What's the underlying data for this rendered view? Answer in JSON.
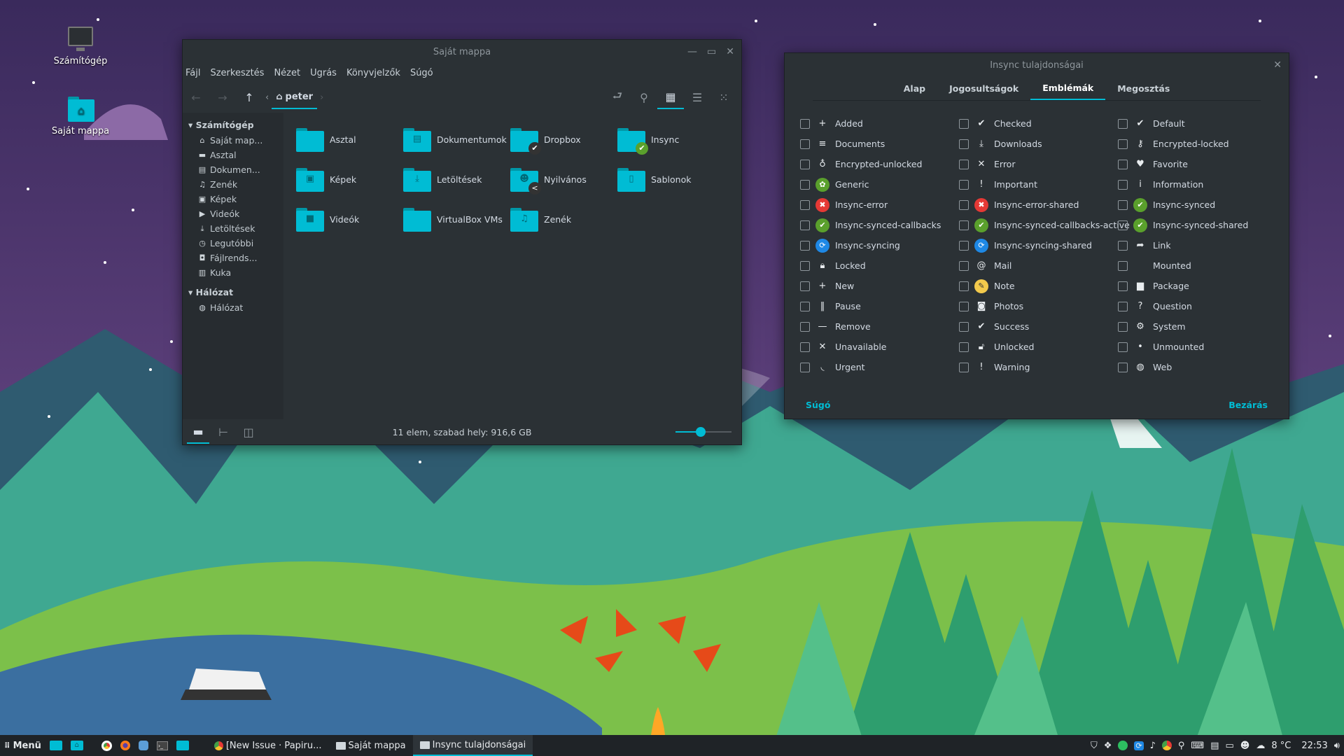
{
  "desktop": {
    "icons": [
      {
        "label": "Számítógép",
        "icon": "monitor-icon"
      },
      {
        "label": "Saját mappa",
        "icon": "home-folder-icon"
      }
    ]
  },
  "file_manager": {
    "title": "Saját mappa",
    "menu": [
      "Fájl",
      "Szerkesztés",
      "Nézet",
      "Ugrás",
      "Könyvjelzők",
      "Súgó"
    ],
    "breadcrumb": "peter",
    "sidebar": {
      "computer_header": "Számítógép",
      "computer_items": [
        {
          "label": "Saját map...",
          "glyph": "⌂"
        },
        {
          "label": "Asztal",
          "glyph": "▬"
        },
        {
          "label": "Dokumen...",
          "glyph": "▤"
        },
        {
          "label": "Zenék",
          "glyph": "♫"
        },
        {
          "label": "Képek",
          "glyph": "▣"
        },
        {
          "label": "Videók",
          "glyph": "▶"
        },
        {
          "label": "Letöltések",
          "glyph": "⤓"
        },
        {
          "label": "Legutóbbi",
          "glyph": "◷"
        },
        {
          "label": "Fájlrends...",
          "glyph": "◘"
        },
        {
          "label": "Kuka",
          "glyph": "▥"
        }
      ],
      "network_header": "Hálózat",
      "network_items": [
        {
          "label": "Hálózat",
          "glyph": "◍"
        }
      ]
    },
    "folders": [
      {
        "name": "Asztal",
        "glyph": "",
        "emblem": ""
      },
      {
        "name": "Dokumentumok",
        "glyph": "▤",
        "emblem": ""
      },
      {
        "name": "Dropbox",
        "glyph": "",
        "emblem": "✔"
      },
      {
        "name": "Insync",
        "glyph": "",
        "emblem": "✔"
      },
      {
        "name": "Képek",
        "glyph": "▣",
        "emblem": ""
      },
      {
        "name": "Letöltések",
        "glyph": "⤓",
        "emblem": ""
      },
      {
        "name": "Nyilvános",
        "glyph": "☻",
        "emblem": "<"
      },
      {
        "name": "Sablonok",
        "glyph": "▯",
        "emblem": ""
      },
      {
        "name": "Videók",
        "glyph": "■",
        "emblem": ""
      },
      {
        "name": "VirtualBox VMs",
        "glyph": "",
        "emblem": ""
      },
      {
        "name": "Zenék",
        "glyph": "♫",
        "emblem": ""
      }
    ],
    "status": "11 elem, szabad hely: 916,6 GB",
    "zoom_fraction": 0.45
  },
  "dialog": {
    "title": "Insync tulajdonságai",
    "tabs": [
      {
        "label": "Alap",
        "active": false
      },
      {
        "label": "Jogosultságok",
        "active": false
      },
      {
        "label": "Emblémák",
        "active": true
      },
      {
        "label": "Megosztás",
        "active": false
      }
    ],
    "emblems": [
      {
        "label": "Added",
        "glyph": "+",
        "color": ""
      },
      {
        "label": "Checked",
        "glyph": "✔",
        "color": ""
      },
      {
        "label": "Default",
        "glyph": "✔",
        "color": ""
      },
      {
        "label": "Documents",
        "glyph": "≡",
        "color": ""
      },
      {
        "label": "Downloads",
        "glyph": "⤓",
        "color": ""
      },
      {
        "label": "Encrypted-locked",
        "glyph": "⚷",
        "color": ""
      },
      {
        "label": "Encrypted-unlocked",
        "glyph": "♁",
        "color": ""
      },
      {
        "label": "Error",
        "glyph": "✕",
        "color": ""
      },
      {
        "label": "Favorite",
        "glyph": "♥",
        "color": ""
      },
      {
        "label": "Generic",
        "glyph": "✿",
        "color": "#5aa02c"
      },
      {
        "label": "Important",
        "glyph": "!",
        "color": ""
      },
      {
        "label": "Information",
        "glyph": "i",
        "color": ""
      },
      {
        "label": "Insync-error",
        "glyph": "✖",
        "color": "#e53935"
      },
      {
        "label": "Insync-error-shared",
        "glyph": "✖",
        "color": "#e53935"
      },
      {
        "label": "Insync-synced",
        "glyph": "✔",
        "color": "#5aa02c"
      },
      {
        "label": "Insync-synced-callbacks",
        "glyph": "✔",
        "color": "#5aa02c"
      },
      {
        "label": "Insync-synced-callbacks-active",
        "glyph": "✔",
        "color": "#5aa02c"
      },
      {
        "label": "Insync-synced-shared",
        "glyph": "✔",
        "color": "#5aa02c"
      },
      {
        "label": "Insync-syncing",
        "glyph": "⟳",
        "color": "#1e88e5"
      },
      {
        "label": "Insync-syncing-shared",
        "glyph": "⟳",
        "color": "#1e88e5"
      },
      {
        "label": "Link",
        "glyph": "➦",
        "color": ""
      },
      {
        "label": "Locked",
        "glyph": "🔒︎",
        "color": ""
      },
      {
        "label": "Mail",
        "glyph": "@",
        "color": ""
      },
      {
        "label": "Mounted",
        "glyph": "",
        "color": ""
      },
      {
        "label": "New",
        "glyph": "+",
        "color": ""
      },
      {
        "label": "Note",
        "glyph": "✎",
        "color": "#f2c94c"
      },
      {
        "label": "Package",
        "glyph": "▆",
        "color": ""
      },
      {
        "label": "Pause",
        "glyph": "‖",
        "color": ""
      },
      {
        "label": "Photos",
        "glyph": "◙",
        "color": ""
      },
      {
        "label": "Question",
        "glyph": "?",
        "color": ""
      },
      {
        "label": "Remove",
        "glyph": "—",
        "color": ""
      },
      {
        "label": "Success",
        "glyph": "✔",
        "color": ""
      },
      {
        "label": "System",
        "glyph": "⚙",
        "color": ""
      },
      {
        "label": "Unavailable",
        "glyph": "✕",
        "color": ""
      },
      {
        "label": "Unlocked",
        "glyph": "🔓︎",
        "color": ""
      },
      {
        "label": "Unmounted",
        "glyph": "•",
        "color": ""
      },
      {
        "label": "Urgent",
        "glyph": "◟",
        "color": ""
      },
      {
        "label": "Warning",
        "glyph": "!",
        "color": ""
      },
      {
        "label": "Web",
        "glyph": "◍",
        "color": ""
      }
    ],
    "help_label": "Súgó",
    "close_label": "Bezárás"
  },
  "taskbar": {
    "menu_label": "Menü",
    "windows": [
      {
        "label": "[New Issue · Papiru...",
        "icon": "chrome-icon",
        "active": false
      },
      {
        "label": "Saját mappa",
        "icon": "folder-icon",
        "active": false
      },
      {
        "label": "Insync tulajdonságai",
        "icon": "folder-icon",
        "active": true
      }
    ],
    "temperature": "8 °C",
    "clock": "22:53"
  },
  "colors": {
    "accent": "#00bcd4",
    "window_bg": "#2b3135",
    "sidebar_bg": "#272c30",
    "taskbar_bg": "#1f2327"
  }
}
